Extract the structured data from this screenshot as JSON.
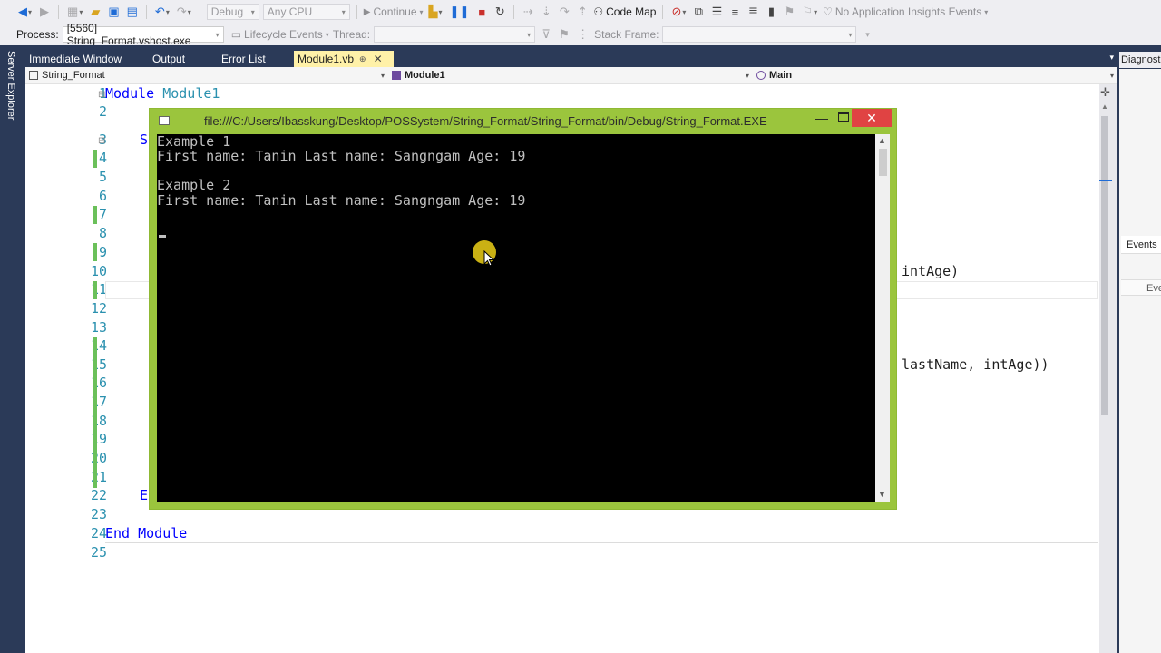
{
  "toolbar1": {
    "config_combo": "Debug",
    "platform_combo": "Any CPU",
    "continue_label": "Continue",
    "codemap_label": "Code Map",
    "insights_label": "No Application Insights Events"
  },
  "toolbar2": {
    "process_label": "Process:",
    "process_value": "[5560] String_Format.vshost.exe",
    "lifecycle_label": "Lifecycle Events",
    "thread_label": "Thread:",
    "stackframe_label": "Stack Frame:"
  },
  "left_strip": {
    "server_explorer": "Server Explorer"
  },
  "tabs": [
    {
      "label": "Immediate Window"
    },
    {
      "label": "Output"
    },
    {
      "label": "Error List"
    },
    {
      "label": "Module1.vb"
    }
  ],
  "right_panel": {
    "diagnostics_tab": "Diagnost",
    "events_tab": "Events",
    "events_sub": "Eve"
  },
  "navbar": {
    "project": "String_Format",
    "module": "Module1",
    "member": "Main"
  },
  "editor": {
    "line_numbers": [
      "1",
      "2",
      "3",
      "4",
      "5",
      "6",
      "7",
      "8",
      "9",
      "10",
      "11",
      "12",
      "13",
      "14",
      "15",
      "16",
      "17",
      "18",
      "19",
      "20",
      "21",
      "22",
      "23",
      "24",
      "25"
    ],
    "line1_kw": "Module",
    "line1_name": "Module1",
    "line3_fragment": "S",
    "line10_fragment": "intAge)",
    "line15_fragment": "lastName, intAge))",
    "line22_fragment": "E",
    "line24_kw": "End Module"
  },
  "console": {
    "title": "file:///C:/Users/Ibasskung/Desktop/POSSystem/String_Format/String_Format/bin/Debug/String_Format.EXE",
    "lines": [
      "Example 1",
      "First name: Tanin Last name: Sangngam Age: 19",
      "",
      "Example 2",
      "First name: Tanin Last name: Sangngam Age: 19"
    ]
  },
  "colors": {
    "vs_blue": "#2b3a58",
    "active_tab": "#fff1a8",
    "console_border": "#9bc53d",
    "close_button": "#e04343",
    "change_bar": "#6bc05a",
    "line_number": "#2b91af",
    "keyword": "#0000ff"
  },
  "icons": [
    "back-icon",
    "forward-icon",
    "new-project-icon",
    "open-icon",
    "save-icon",
    "save-all-icon",
    "undo-icon",
    "redo-icon",
    "continue-icon",
    "pause-icon",
    "stop-icon",
    "restart-icon",
    "step-over-icon",
    "code-map-icon",
    "bookmark-icon",
    "filter-icon"
  ]
}
